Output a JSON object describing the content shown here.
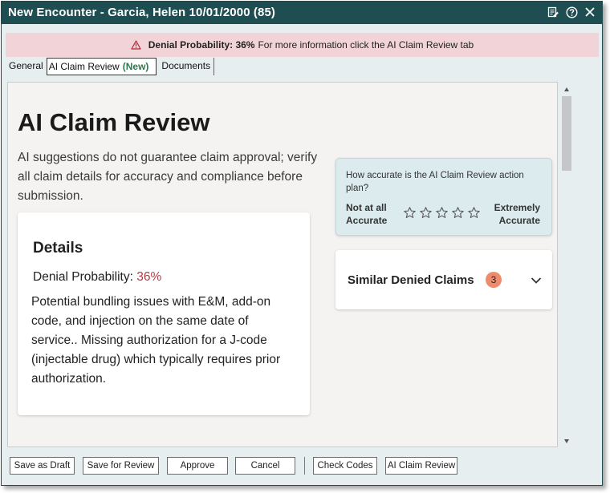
{
  "window": {
    "title": "New Encounter - Garcia, Helen  10/01/2000 (85)",
    "icons": [
      "edit-note-icon",
      "help-icon",
      "close-icon"
    ]
  },
  "banner": {
    "icon": "warning-icon",
    "bold": "Denial Probability: 36%",
    "text": "For more information click the AI Claim Review tab"
  },
  "tabs": [
    {
      "label": "General"
    },
    {
      "label": "AI Claim Review",
      "badge": "(New)"
    },
    {
      "label": "Documents"
    }
  ],
  "content": {
    "title": "AI Claim Review",
    "intro": "AI suggestions do not guarantee claim approval; verify all claim details for accuracy and compliance before submission.",
    "details": {
      "heading": "Details",
      "prob_label": "Denial Probability:",
      "prob_value": "36%",
      "description": "Potential bundling issues with E&M, add-on code, and injection on the same date of service.. Missing authorization for a J-code (injectable drug) which typically requires prior authorization."
    },
    "rating": {
      "question": "How accurate is the AI Claim Review action plan?",
      "low_line1": "Not at all",
      "low_line2": "Accurate",
      "high_line1": "Extremely",
      "high_line2": "Accurate",
      "star_count": 5,
      "selected": 0
    },
    "similar": {
      "label": "Similar Denied Claims",
      "count": "3"
    }
  },
  "footer": {
    "save_draft": "Save as Draft",
    "save_review": "Save for Review",
    "approve": "Approve",
    "cancel": "Cancel",
    "check_codes": "Check Codes",
    "ai_review": "AI Claim Review"
  },
  "colors": {
    "titlebar": "#1f4e52",
    "banner": "#f2d4d8",
    "new_badge": "#2b7a4b",
    "denial_pct": "#b33a44",
    "count_badge": "#ee8a6e",
    "rating_bg": "#dcebee"
  }
}
